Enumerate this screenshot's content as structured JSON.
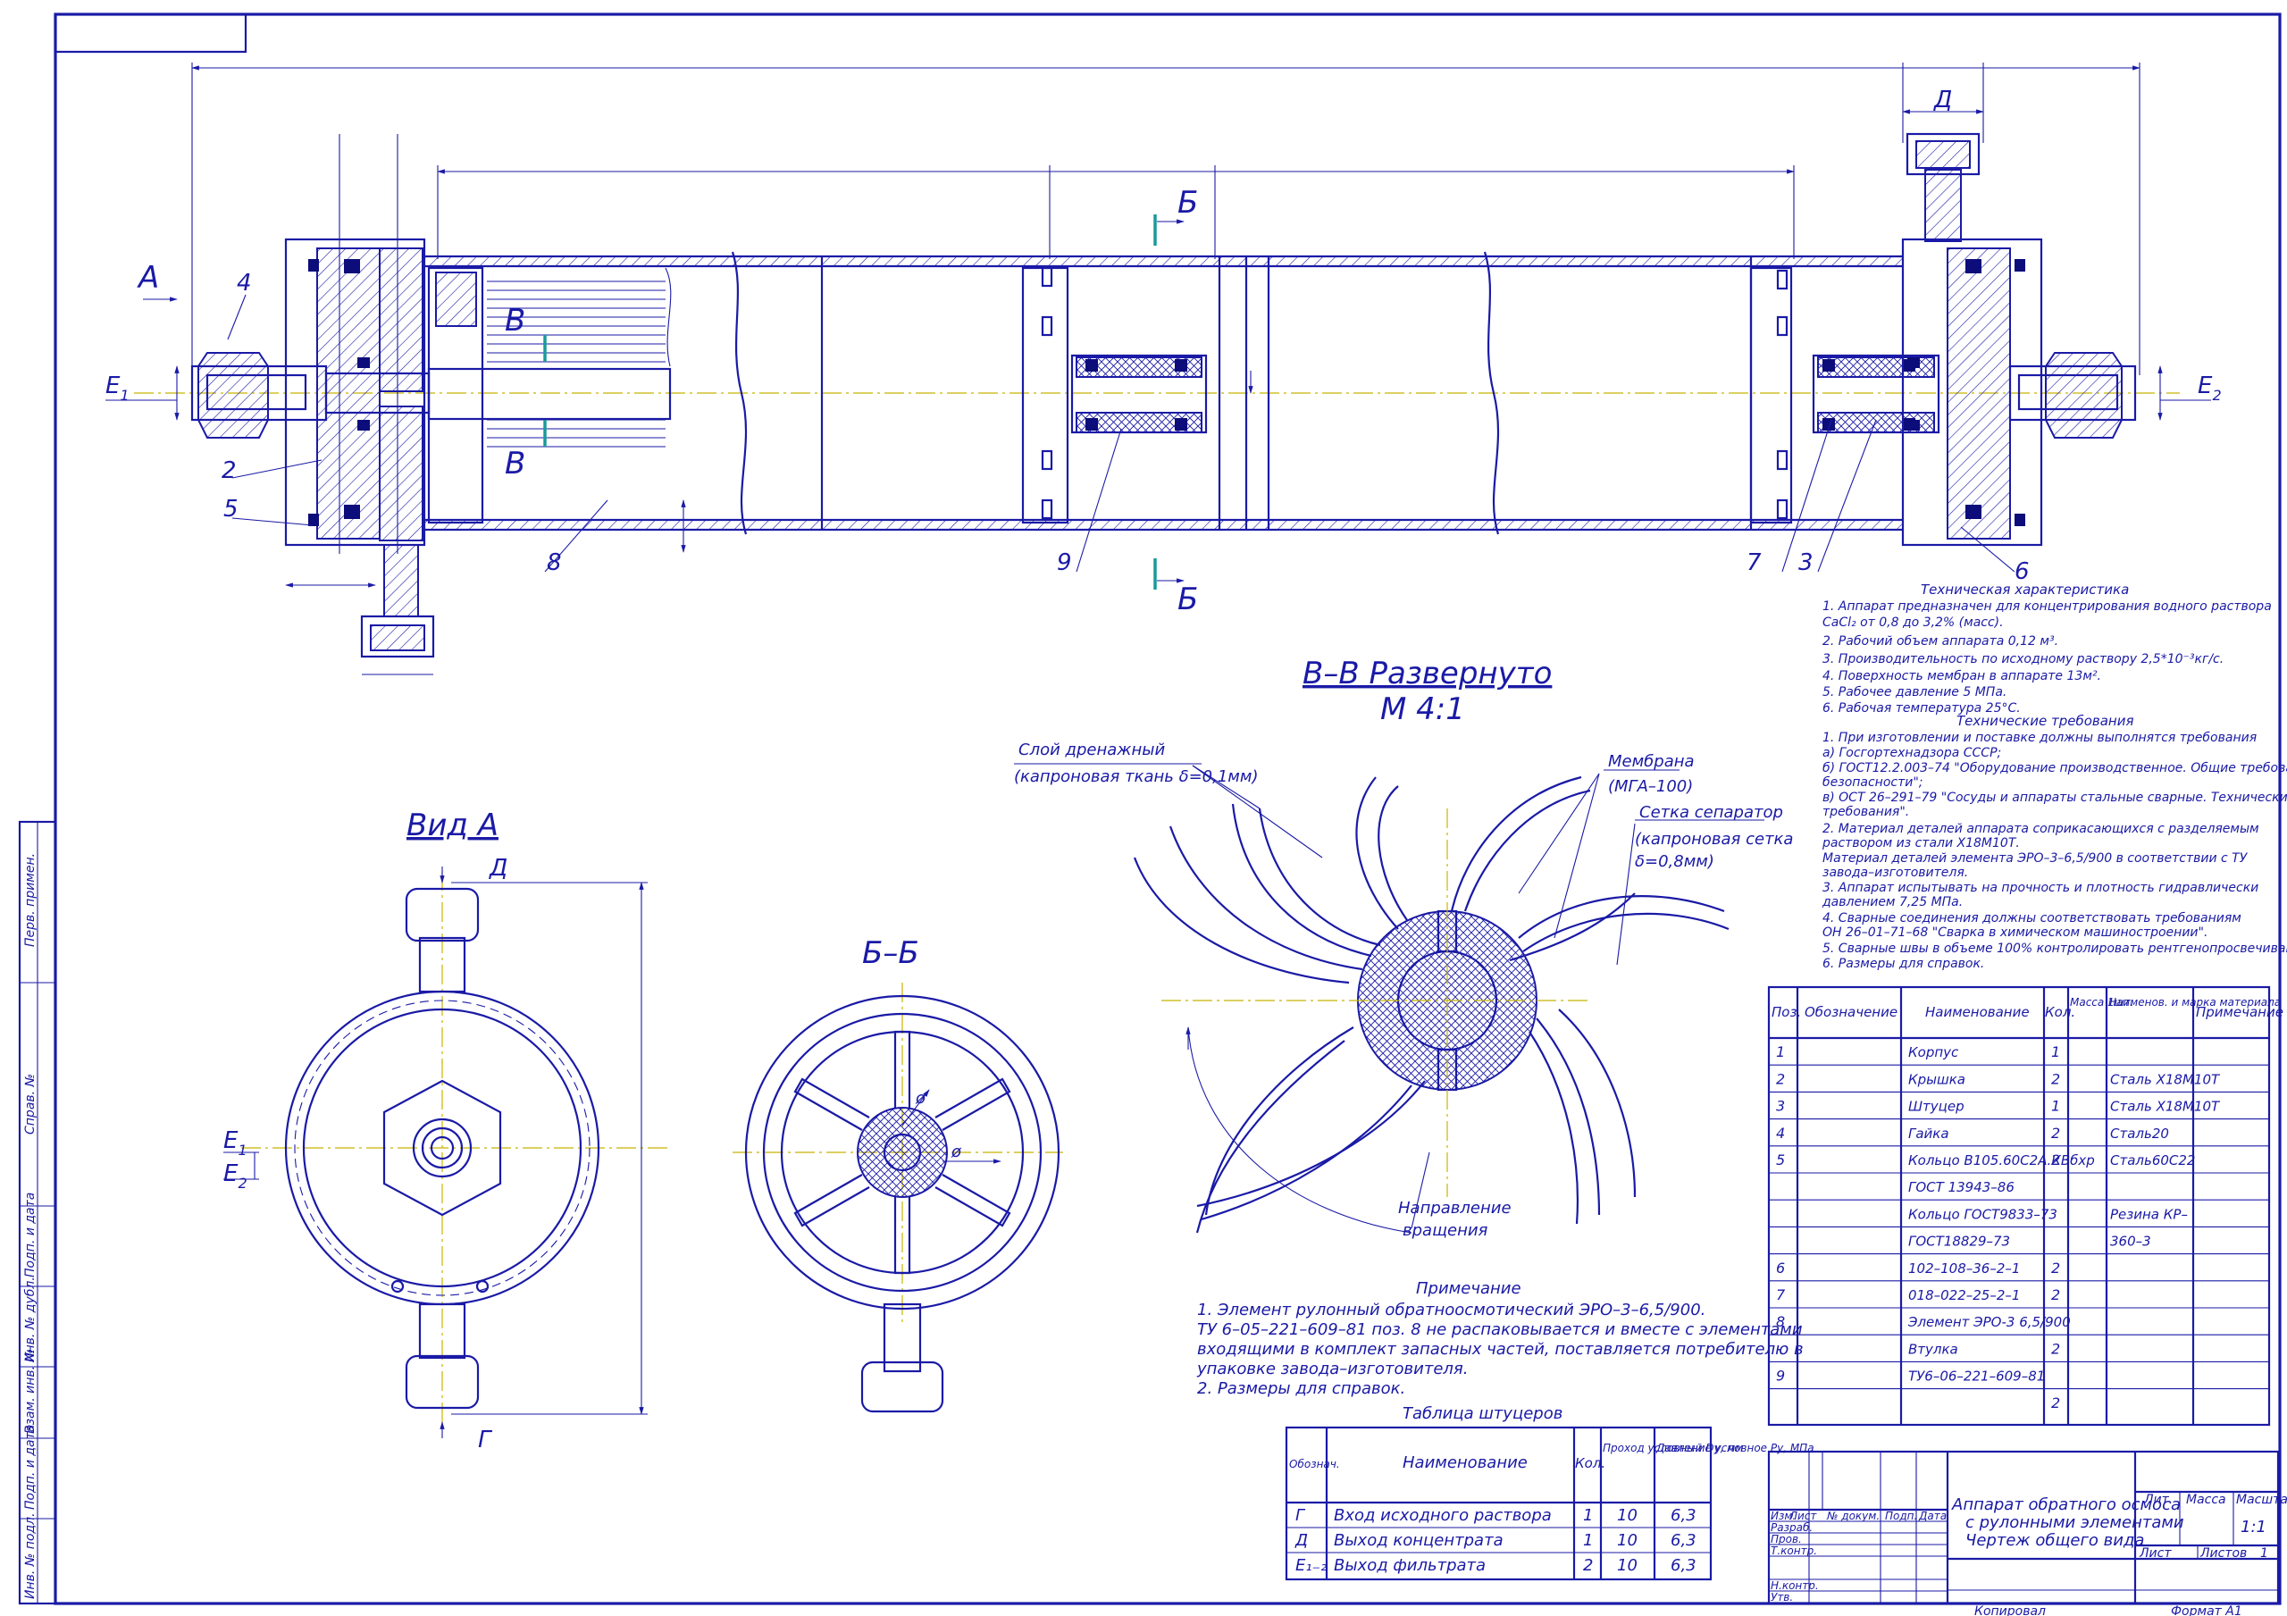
{
  "callouts": {
    "arrow_a": "А",
    "b_top": "Б",
    "b_bottom": "Б",
    "d_top": "Д",
    "v_top": "В",
    "v_bottom": "В",
    "e1": "E",
    "e1_sub": "1",
    "e2": "E",
    "e2_sub": "2",
    "pos_2": "2",
    "pos_3": "3",
    "pos_4": "4",
    "pos_5": "5",
    "pos_6": "6",
    "pos_7": "7",
    "pos_8": "8",
    "pos_9": "9"
  },
  "view_a": {
    "title": "Вид А",
    "d_label": "Д",
    "g_label": "Г",
    "e1": "E",
    "e1_sub": "1",
    "e2": "E",
    "e2_sub": "2"
  },
  "section_bb": {
    "title": "Б–Б",
    "dia_1": "ø",
    "dia_2": "ø"
  },
  "section_vv": {
    "title": "В–В Развернуто",
    "scale": "М 4:1",
    "drain_label_1": "Слой дренажный",
    "drain_label_2": "(капроновая ткань δ=0,1мм)",
    "membrane_label_1": "Мембрана",
    "membrane_label_2": "(МГА–100)",
    "separator_label_1": "Сетка сепаратор",
    "separator_label_2": "(капроновая сетка",
    "separator_label_3": "δ=0,8мм)",
    "rotation_label_1": "Направление",
    "rotation_label_2": "вращения"
  },
  "tech_characteristics": {
    "title": "Техническая характеристика",
    "lines": [
      "1. Аппарат предназначен для концентрирования водного раствора",
      "CaCl₂ от 0,8 до 3,2% (масс).",
      "2. Рабочий объем аппарата  0,12 м³.",
      "3. Производительность по исходному раствору 2,5*10⁻³кг/с.",
      "4. Поверхность мембран в аппарате 13м².",
      "5. Рабочее давление 5 МПа.",
      "6. Рабочая температура 25°С."
    ]
  },
  "tech_requirements": {
    "title": "Технические требования",
    "lines": [
      "1. При изготовлении и поставке должны выполнятся требования",
      "   а) Госгортехнадзора СССР;",
      "   б) ГОСТ12.2.003–74 \"Оборудование производственное. Общие требования",
      "       безопасности\";",
      "   в) ОСТ 26–291–79 \"Сосуды и аппараты стальные сварные. Технические",
      "       требования\".",
      "2. Материал деталей аппарата соприкасающихся с разделяемым",
      "раствором из стали Х18М10Т.",
      "Материал деталей элемента ЭРО–3–6,5/900 в соответствии с ТУ",
      "завода–изготовителя.",
      "3. Аппарат испытывать на прочность и плотность гидравлически",
      "давлением 7,25 МПа.",
      "4. Сварные соединения должны соответствовать требованиям",
      "ОН 26–01–71–68 \"Сварка в химическом машиностроении\".",
      "5. Сварные швы в объеме 100% контролировать рентгенопросвечиванием.",
      "6. Размеры для справок."
    ]
  },
  "note": {
    "title": "Примечание",
    "lines": [
      "1. Элемент рулонный обратноосмотический ЭРО–3–6,5/900.",
      "   ТУ 6–05–221–609–81 поз. 8 не распаковывается и вместе с элементами",
      "   входящими в комплект запасных частей, поставляется потребителю в",
      "   упаковке завода–изготовителя.",
      "2. Размеры для справок."
    ]
  },
  "spec_table": {
    "headers": [
      "Поз.",
      "Обозначение",
      "Наименование",
      "Кол.",
      "Масса 1шт.",
      "Наименов. и марка материала",
      "Примечание"
    ],
    "rows": [
      [
        "1",
        "",
        "Корпус",
        "1",
        "",
        ""
      ],
      [
        "2",
        "",
        "Крышка",
        "2",
        "",
        "Сталь Х18М10Т"
      ],
      [
        "3",
        "",
        "Штуцер",
        "1",
        "",
        "Сталь Х18М10Т"
      ],
      [
        "4",
        "",
        "Гайка",
        "2",
        "",
        "Сталь20"
      ],
      [
        "5",
        "",
        "Кольцо В105.60С2А.КВбхр",
        "2",
        "",
        "Сталь60С22"
      ],
      [
        "",
        "",
        "ГОСТ 13943–86",
        "",
        "",
        ""
      ],
      [
        "",
        "",
        "Кольцо ГОСТ9833–73",
        "",
        "",
        "Резина КР–"
      ],
      [
        "",
        "",
        "ГОСТ18829–73",
        "",
        "",
        "360–3"
      ],
      [
        "6",
        "",
        "102–108–36–2–1",
        "2",
        "",
        ""
      ],
      [
        "7",
        "",
        "018–022–25–2–1",
        "2",
        "",
        ""
      ],
      [
        "8",
        "",
        "Элемент ЭРО-3 6,5/900",
        "",
        "",
        ""
      ],
      [
        "",
        "",
        "Втулка",
        "2",
        "",
        ""
      ],
      [
        "9",
        "",
        "ТУ6–06–221–609–81",
        "",
        "",
        ""
      ],
      [
        "",
        "",
        "",
        "2",
        "",
        ""
      ]
    ]
  },
  "nozzle_table": {
    "title": "Таблица штуцеров",
    "headers": [
      "Обознач.",
      "Наименование",
      "Кол.",
      "Проход условный Dу, мм",
      "Давление условное Pу, МПа"
    ],
    "rows": [
      [
        "Г",
        "Вход исходного раствора",
        "1",
        "10",
        "6,3"
      ],
      [
        "Д",
        "Выход концентрата",
        "1",
        "10",
        "6,3"
      ],
      [
        "Е₁₋₂",
        "Выход фильтрата",
        "2",
        "10",
        "6,3"
      ]
    ]
  },
  "title_block": {
    "name_1": "Аппарат обратного осмоса",
    "name_2": "с рулонными элементами",
    "name_3": "Чертеж общего вида",
    "lit": "Лит.",
    "massa": "Масса",
    "masshtab": "Масштаб",
    "scale_value": "1:1",
    "list": "Лист",
    "listov": "Листов",
    "listov_value": "1",
    "izm": "Изм.",
    "list_col": "Лист",
    "doc": "№ докум.",
    "podp": "Подп.",
    "data": "Дата",
    "razrab": "Разраб.",
    "prov": "Пров.",
    "tkontr": "Т.контр.",
    "nkontr": "Н.контр.",
    "utv": "Утв.",
    "copied": "Копировал",
    "format": "Формат   А1"
  },
  "side_stamps": [
    "Перв. примен.",
    "Справ. №",
    "Подп. и дата",
    "Инв. № дубл.",
    "Взам. инв. №",
    "Подп. и дата",
    "Инв. № подл."
  ]
}
